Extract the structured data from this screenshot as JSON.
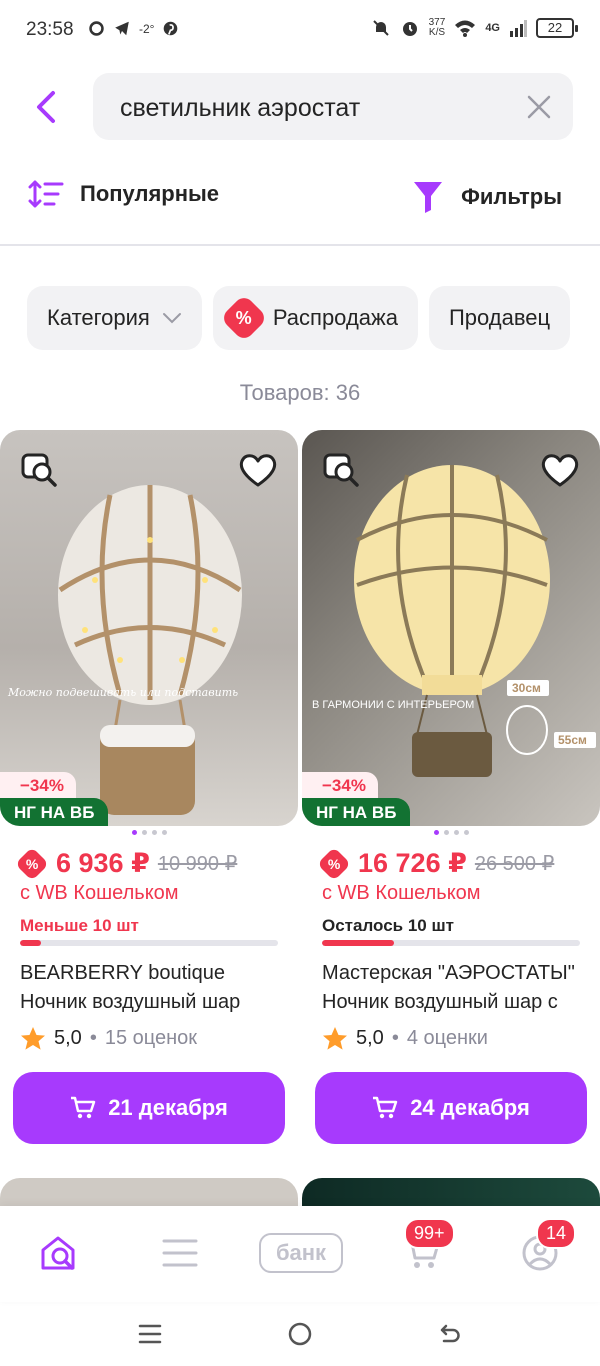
{
  "status_bar": {
    "time": "23:58",
    "temp": "-2°",
    "net_speed_value": "377",
    "net_speed_unit": "K/S",
    "network": "4G",
    "battery": "22",
    "icons": [
      "chat-icon",
      "telegram-icon",
      "pinterest-icon",
      "mute-icon",
      "alarm-icon",
      "wifi-icon",
      "signal-icon",
      "battery-icon"
    ]
  },
  "search": {
    "query": "светильник аэростат"
  },
  "toolbar": {
    "sort_label": "Популярные",
    "filter_label": "Фильтры"
  },
  "chips": [
    {
      "label": "Категория"
    },
    {
      "label": "Распродажа",
      "badge": "%"
    },
    {
      "label": "Продавец"
    }
  ],
  "results_count": "Товаров: 36",
  "products": [
    {
      "discount": "−34%",
      "promo": "НГ НА ВБ",
      "image_text": "Можно подвешивать или подставить",
      "price": "6 936 ₽",
      "old_price": "10 990 ₽",
      "wallet_text": "с WB Кошельком",
      "stock_text": "Меньше 10 шт",
      "stock_level": 0.08,
      "brand": "BEARBERRY boutique",
      "title": "Ночник воздушный шар",
      "rating": "5,0",
      "reviews": "15 оценок",
      "delivery": "21 декабря"
    },
    {
      "discount": "−34%",
      "promo": "НГ НА ВБ",
      "image_text": "В ГАРМОНИИ С ИНТЕРЬЕРОМ",
      "dim_width": "30см",
      "dim_height": "55см",
      "price": "16 726 ₽",
      "old_price": "26 500 ₽",
      "wallet_text": "с WB Кошельком",
      "stock_text": "Осталось 10 шт",
      "stock_level": 0.28,
      "brand": "Мастерская \"АЭРОСТАТЫ\"",
      "title": "Ночник воздушный шар с",
      "rating": "5,0",
      "reviews": "4 оценки",
      "delivery": "24 декабря"
    }
  ],
  "bottom_nav": {
    "bank_label": "банк",
    "cart_badge": "99+",
    "profile_badge": "14"
  },
  "colors": {
    "accent": "#a73afd",
    "sale": "#f0364e",
    "promo": "#127232"
  }
}
